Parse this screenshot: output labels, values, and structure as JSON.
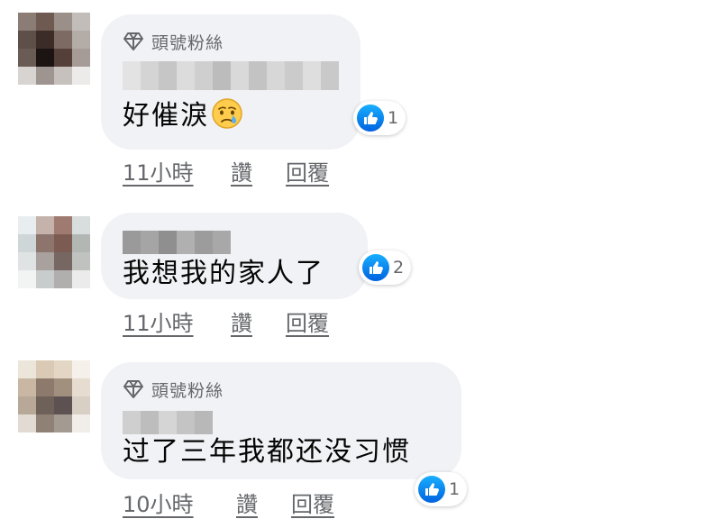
{
  "comments": [
    {
      "badge": "頭號粉絲",
      "text": "好催淚",
      "emoji": "crying-face-emoji",
      "reaction_count": "1",
      "time": "11小時",
      "like_label": "讚",
      "reply_label": "回覆"
    },
    {
      "badge": "",
      "text": "我想我的家人了",
      "reaction_count": "2",
      "time": "11小時",
      "like_label": "讚",
      "reply_label": "回覆"
    },
    {
      "badge": "頭號粉絲",
      "text": "过了三年我都还没习惯",
      "reaction_count": "1",
      "time": "10小時",
      "like_label": "讚",
      "reply_label": "回覆"
    }
  ],
  "colors": {
    "bubble_bg": "#f0f2f5",
    "secondary_text": "#65676b",
    "like_blue": "#1877f2"
  }
}
